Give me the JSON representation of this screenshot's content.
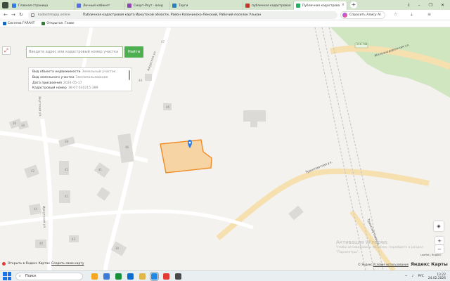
{
  "browser": {
    "tabs": [
      {
        "label": "Главная страница",
        "color": "#2f7de1"
      },
      {
        "label": "Личный кабинет",
        "color": "#5b6ee1"
      },
      {
        "label": "Смарт-Роут - вход",
        "color": "#8e44ad"
      },
      {
        "label": "Торги",
        "color": "#2980b9"
      },
      {
        "label": "публичная кадастровая",
        "color": "#c0392b"
      },
      {
        "label": "Публичная кадастрова",
        "color": "#27ae60",
        "active": true
      }
    ],
    "url_site": "kadastrmapp.online",
    "page_title": "Публичная кадастровая карта Иркутской области, Район Казачинско-Ленский, Рабочий поселок Улькан",
    "assistant_label": "Спросить Алису AI",
    "bookmarks": [
      {
        "label": "Система ГАРАНТ",
        "color": "#1565c0"
      },
      {
        "label": "Открытая. Главн",
        "color": "#2e7d32"
      }
    ]
  },
  "map": {
    "search": {
      "placeholder": "Введите адрес или кадастровый номер участка",
      "button": "Найти"
    },
    "info": {
      "rows": [
        {
          "label": "Вид объекта недвижимости",
          "value": "Земельный участок"
        },
        {
          "label": "Вид земельного участка",
          "value": "Землепользование"
        },
        {
          "label": "Дата присвоения",
          "value": "2024-05-17"
        },
        {
          "label": "Кадастровый номер",
          "value": "38:07:030215:389"
        }
      ]
    },
    "street_labels": {
      "zheleznodorozhnaya": "Железнодорожная ул.",
      "transportnaya": "Транспортная ул.",
      "transportnaya_2": "Транспортная ул.",
      "yakutskaya": "Якутская ул.",
      "irkutskaya": "Иркутская ул.",
      "amurskaya": "Амурская ул.",
      "road_code": "25К-708"
    },
    "house_numbers": [
      "47",
      "46",
      "44",
      "46",
      "45",
      "38",
      "41",
      "42",
      "44",
      "40",
      "43",
      "39",
      "41",
      "36",
      "34"
    ],
    "zoom_in": "+",
    "zoom_out": "−",
    "open_ymaps": "Открыть в Яндекс Картах",
    "create_map": "Создать свою карту",
    "watermark_title": "Активация Windows",
    "watermark_sub1": "Чтобы активировать Windows, перейдите в раздел",
    "watermark_sub2": "\"Параметры\".",
    "attribution": "Leaflet | Яндекс",
    "yandex_terms_prefix": "© Яндекс",
    "yandex_terms_link": "Условия использования",
    "yandex_logo": "Яндекс Карты",
    "parcel_color": "#f7a94a",
    "marker_color": "#2f7de1"
  },
  "taskbar": {
    "search_placeholder": "Поиск",
    "lang": "РУС",
    "time": "13:22",
    "date": "24.02.2026",
    "apps": [
      "#f5a623",
      "#3d7bd9",
      "#1a8f3a",
      "#0b6fd1",
      "#e0b84a",
      "#1e88e5",
      "#e53935",
      "#4a4a4a"
    ]
  }
}
